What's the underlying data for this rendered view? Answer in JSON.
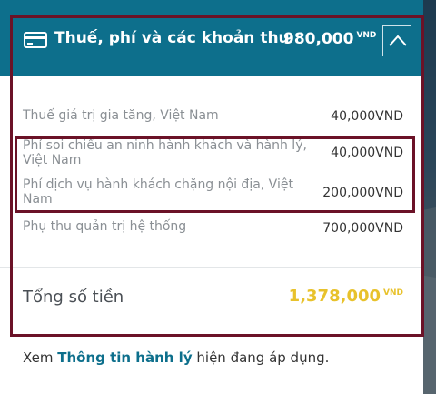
{
  "header": {
    "title": "Thuế, phí và các khoản thu",
    "amount": "980,000",
    "currency": "VND",
    "icon": "credit-card-icon",
    "collapse_icon": "chevron-up-icon"
  },
  "rows": [
    {
      "label": "Thuế giá trị gia tăng, Việt Nam",
      "amount": "40,000",
      "currency": "VND"
    },
    {
      "label": "Phí soi chiếu an ninh hành khách và hành lý, Việt Nam",
      "amount": "40,000",
      "currency": "VND"
    },
    {
      "label": "Phí dịch vụ hành khách chặng nội địa, Việt Nam",
      "amount": "200,000",
      "currency": "VND"
    },
    {
      "label": "Phụ thu quản trị hệ thống",
      "amount": "700,000",
      "currency": "VND"
    }
  ],
  "total": {
    "label": "Tổng số tiền",
    "amount": "1,378,000",
    "currency": "VND"
  },
  "footer": {
    "prefix": "Xem",
    "link": "Thông tin hành lý",
    "suffix": "hiện đang áp dụng."
  },
  "colors": {
    "header_bg": "#0d6f8c",
    "total_accent": "#e8c22c",
    "highlight_outline": "#6b1227",
    "link": "#0d6f8c"
  }
}
